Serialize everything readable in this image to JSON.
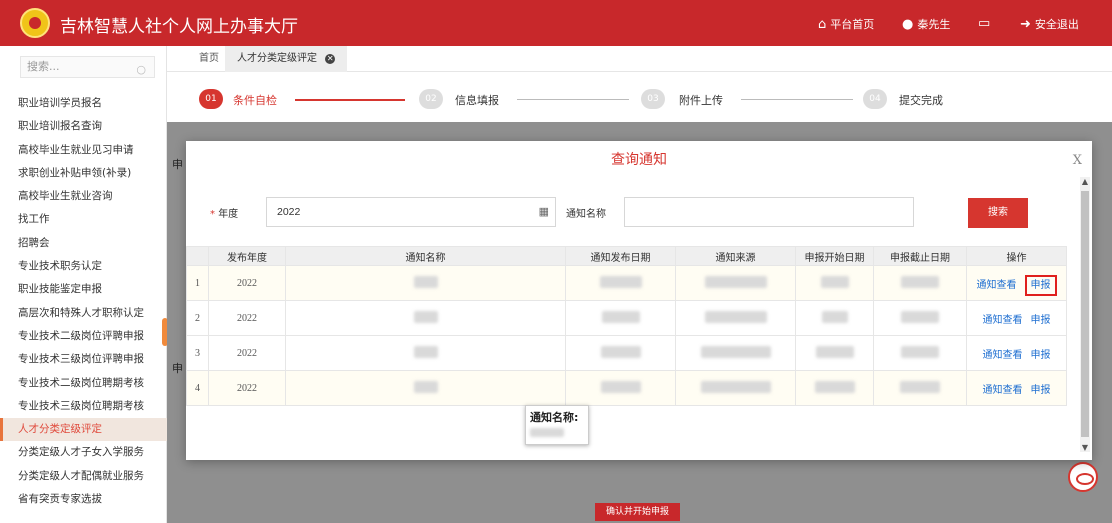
{
  "header": {
    "title": "吉林智慧人社个人网上办事大厅",
    "nav": [
      {
        "label": "平台首页",
        "icon": "home-icon"
      },
      {
        "label": "秦先生",
        "icon": "user-icon"
      },
      {
        "label": "",
        "icon": "message-icon"
      },
      {
        "label": "安全退出",
        "icon": "logout-icon"
      }
    ],
    "brand_color": "#c8282b"
  },
  "sidebar": {
    "search_placeholder": "搜索...",
    "items": [
      {
        "label": "职业培训学员报名"
      },
      {
        "label": "职业培训报名查询"
      },
      {
        "label": "高校毕业生就业见习申请"
      },
      {
        "label": "求职创业补贴申领(补录)"
      },
      {
        "label": "高校毕业生就业咨询"
      },
      {
        "label": "找工作"
      },
      {
        "label": "招聘会"
      },
      {
        "label": "专业技术职务认定"
      },
      {
        "label": "职业技能鉴定申报"
      },
      {
        "label": "高层次和特殊人才职称认定"
      },
      {
        "label": "专业技术二级岗位评聘申报"
      },
      {
        "label": "专业技术三级岗位评聘申报"
      },
      {
        "label": "专业技术二级岗位聘期考核"
      },
      {
        "label": "专业技术三级岗位聘期考核"
      },
      {
        "label": "人才分类定级评定",
        "active": true
      },
      {
        "label": "分类定级人才子女入学服务"
      },
      {
        "label": "分类定级人才配偶就业服务"
      },
      {
        "label": "省有突贡专家选拔"
      }
    ]
  },
  "tabs": {
    "home": "首页",
    "current": "人才分类定级评定"
  },
  "steps": [
    {
      "num": "01",
      "label": "条件自检",
      "active": true
    },
    {
      "num": "02",
      "label": "信息填报",
      "active": false
    },
    {
      "num": "03",
      "label": "附件上传",
      "active": false
    },
    {
      "num": "04",
      "label": "提交完成",
      "active": false
    }
  ],
  "background": {
    "fragment_1": "申",
    "fragment_2": "申",
    "confirm_button": "确认并开始申报"
  },
  "modal": {
    "title": "查询通知",
    "close": "X",
    "year_label": "年度",
    "year_value": "2022",
    "name_label": "通知名称",
    "name_value": "",
    "search_button": "搜索",
    "columns": [
      "",
      "发布年度",
      "通知名称",
      "通知发布日期",
      "通知来源",
      "申报开始日期",
      "申报截止日期",
      "操作"
    ],
    "rows": [
      {
        "index": "1",
        "year": "2022",
        "view": "通知查看",
        "apply": "申报",
        "highlighted": true
      },
      {
        "index": "2",
        "year": "2022",
        "view": "通知查看",
        "apply": "申报",
        "highlighted": false
      },
      {
        "index": "3",
        "year": "2022",
        "view": "通知查看",
        "apply": "申报",
        "highlighted": false
      },
      {
        "index": "4",
        "year": "2022",
        "view": "通知查看",
        "apply": "申报",
        "highlighted": true
      }
    ],
    "tooltip_label": "通知名称:"
  }
}
